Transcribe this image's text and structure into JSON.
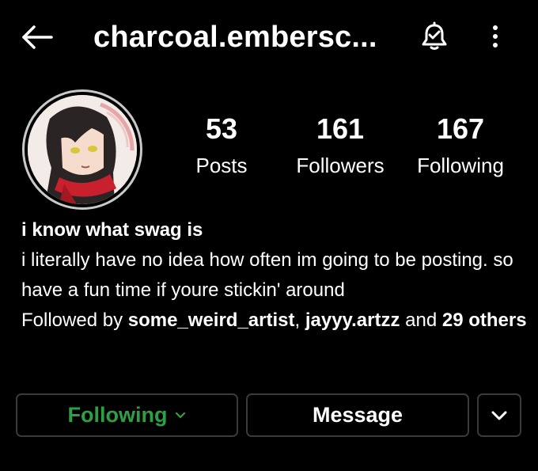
{
  "header": {
    "username": "charcoal.embersc...",
    "icons": {
      "back": "arrow-left-icon",
      "notifications": "bell-icon",
      "more": "more-vertical-icon"
    }
  },
  "profile": {
    "avatar": "profile-avatar",
    "stats": {
      "posts": {
        "count": "53",
        "label": "Posts"
      },
      "followers": {
        "count": "161",
        "label": "Followers"
      },
      "following": {
        "count": "167",
        "label": "Following"
      }
    },
    "bio": {
      "name": "i know what swag is",
      "text": "i literally have no idea how often im going to be posting. so have a fun time if youre stickin' around",
      "followed_by_prefix": "Followed by ",
      "followed_by_user1": "some_weird_artist",
      "followed_by_sep": ", ",
      "followed_by_user2": "jayyy.artzz",
      "followed_by_and": " and ",
      "followed_by_others": "29 others"
    }
  },
  "actions": {
    "following_label": "Following",
    "message_label": "Message",
    "following_color": "#2ea043",
    "icons": {
      "following_chevron": "chevron-down-icon",
      "dropdown": "chevron-down-icon"
    }
  }
}
